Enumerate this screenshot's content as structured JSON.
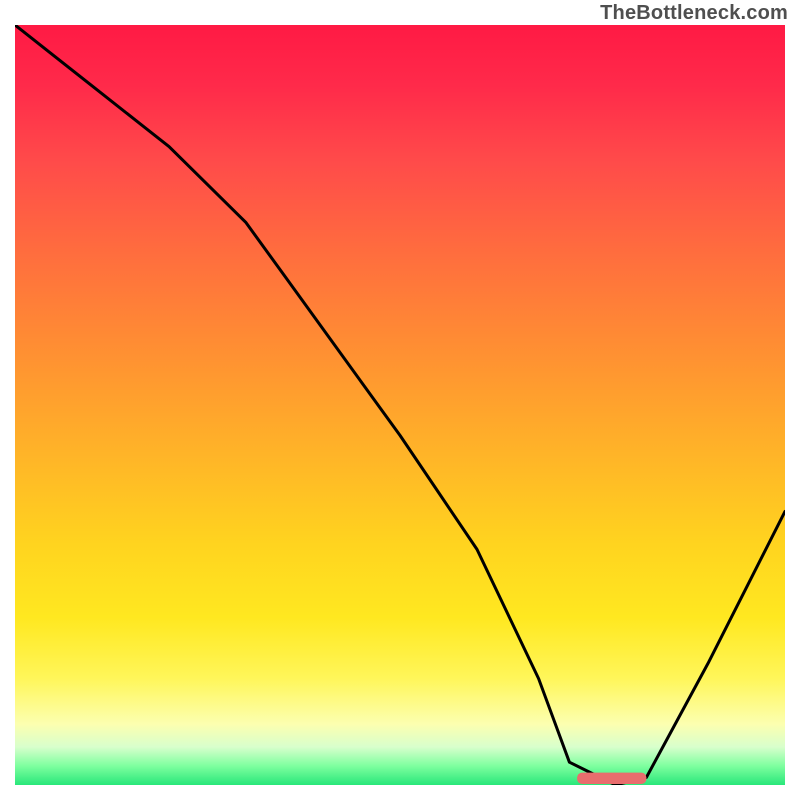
{
  "watermark": "TheBottleneck.com",
  "chart_data": {
    "type": "line",
    "title": "",
    "xlabel": "",
    "ylabel": "",
    "xlim": [
      0,
      100
    ],
    "ylim": [
      0,
      100
    ],
    "grid": false,
    "background_gradient": {
      "direction": "vertical",
      "stops": [
        {
          "pos": 0.0,
          "color": "#ff1a44"
        },
        {
          "pos": 0.18,
          "color": "#ff4b4a"
        },
        {
          "pos": 0.42,
          "color": "#ff8d33"
        },
        {
          "pos": 0.68,
          "color": "#ffd31f"
        },
        {
          "pos": 0.86,
          "color": "#fff65a"
        },
        {
          "pos": 0.95,
          "color": "#d8ffcc"
        },
        {
          "pos": 1.0,
          "color": "#29e77a"
        }
      ]
    },
    "series": [
      {
        "name": "bottleneck-curve",
        "color": "#000000",
        "x": [
          0,
          10,
          20,
          30,
          40,
          50,
          60,
          68,
          72,
          78,
          82,
          90,
          100
        ],
        "y": [
          100,
          92,
          84,
          74,
          60,
          46,
          31,
          14,
          3,
          0,
          1,
          16,
          36
        ]
      }
    ],
    "marker": {
      "name": "optimal-zone",
      "shape": "rounded-bar",
      "color": "#e86d6d",
      "x_start": 73,
      "x_end": 82,
      "y": 0,
      "height_pct": 1.5
    }
  }
}
